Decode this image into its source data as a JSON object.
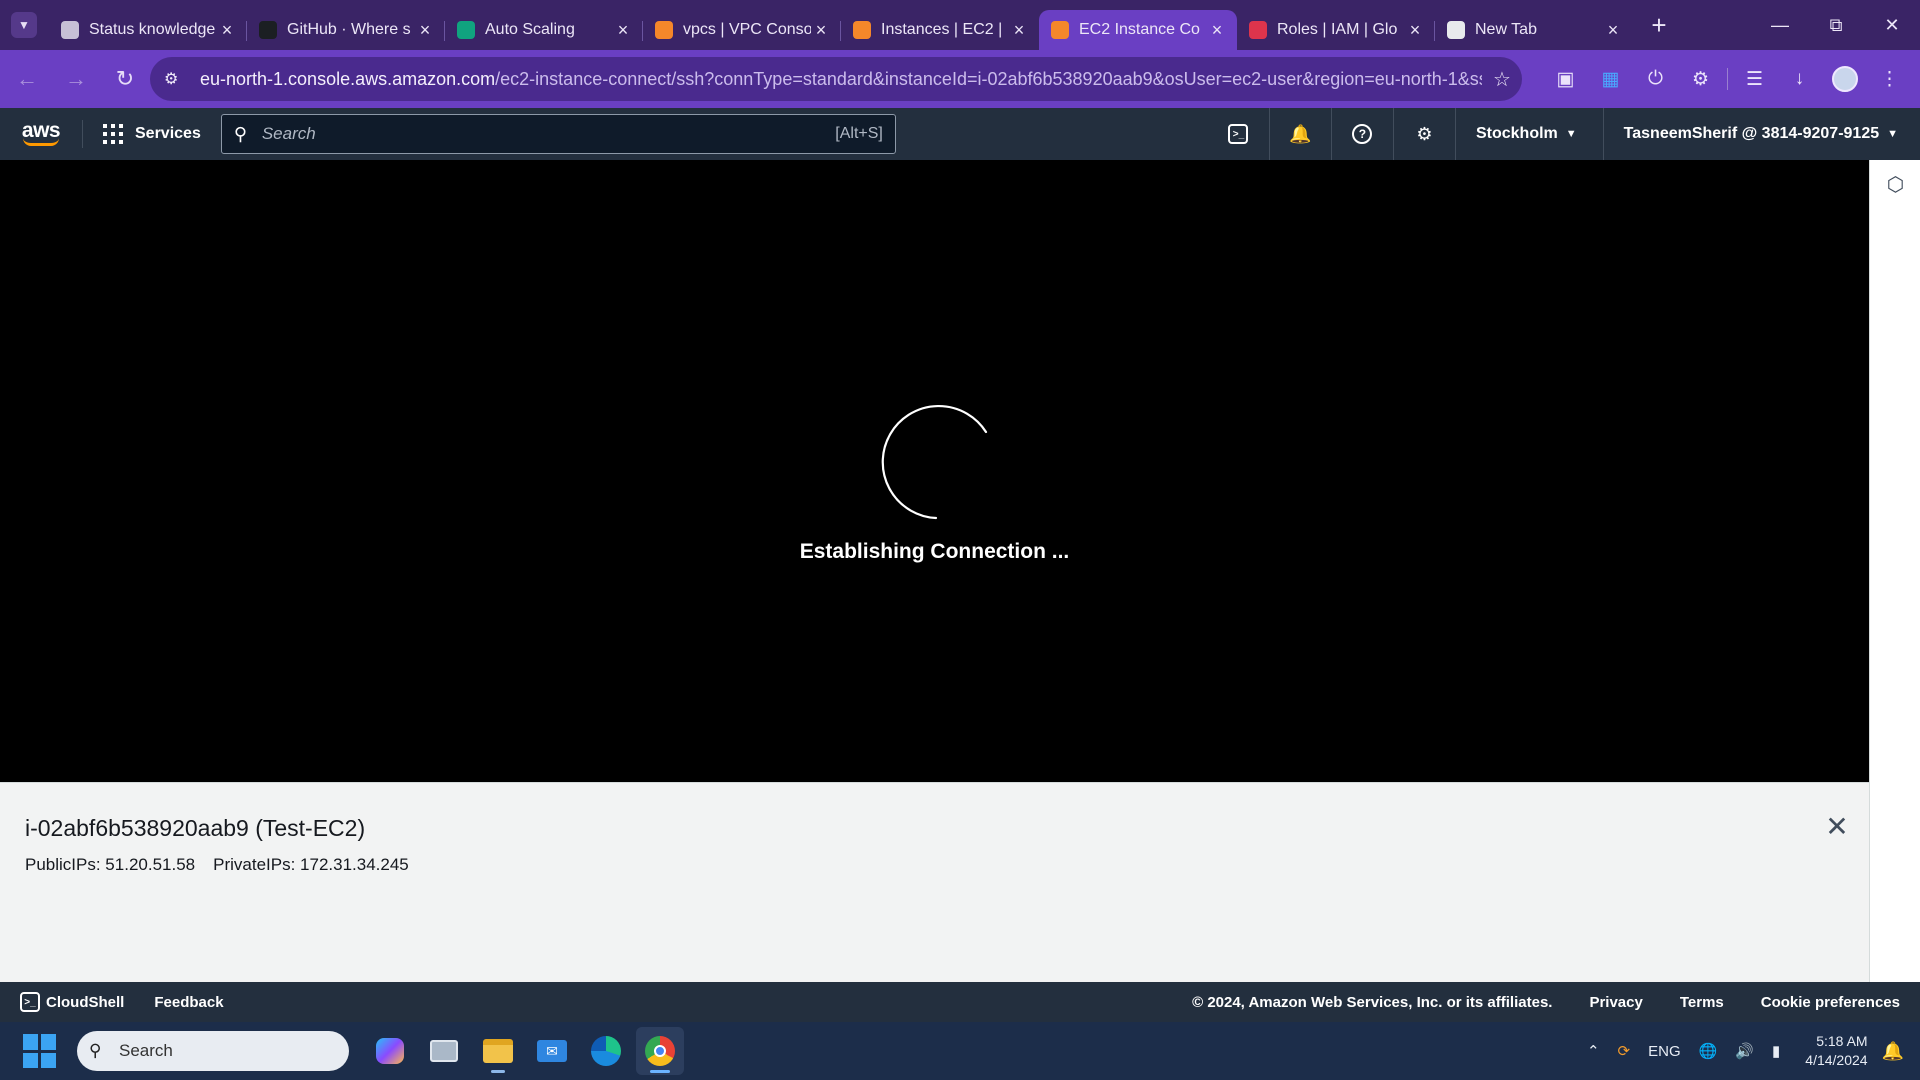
{
  "browser": {
    "tabs": [
      {
        "label": "Status knowledge",
        "favicon": "status-favicon",
        "color": "#c7c0d6",
        "active": false
      },
      {
        "label": "GitHub · Where s",
        "favicon": "github-favicon",
        "color": "#1b1f23",
        "active": false
      },
      {
        "label": "Auto Scaling",
        "favicon": "chatgpt-favicon",
        "color": "#10a37f",
        "active": false
      },
      {
        "label": "vpcs | VPC Conso",
        "favicon": "aws-vpc-favicon",
        "color": "#f5872a",
        "active": false
      },
      {
        "label": "Instances | EC2 |",
        "favicon": "aws-ec2-favicon",
        "color": "#f5872a",
        "active": false
      },
      {
        "label": "EC2 Instance Co",
        "favicon": "aws-ec2-favicon",
        "color": "#f5872a",
        "active": true
      },
      {
        "label": "Roles | IAM | Glo",
        "favicon": "aws-iam-favicon",
        "color": "#dd344c",
        "active": false
      },
      {
        "label": "New Tab",
        "favicon": "chrome-favicon",
        "color": "#e8eaed",
        "active": false
      }
    ],
    "url_host": "eu-north-1.console.aws.amazon.com",
    "url_path": "/ec2-instance-connect/ssh?connType=standard&instanceId=i-02abf6b538920aab9&osUser=ec2-user&region=eu-north-1&ss..."
  },
  "aws": {
    "logo_text": "aws",
    "services_label": "Services",
    "search_placeholder": "Search",
    "search_shortcut": "[Alt+S]",
    "region": "Stockholm",
    "account": "TasneemSherif @ 3814-9207-9125"
  },
  "connect": {
    "status": "Establishing Connection ...",
    "instance_title": "i-02abf6b538920aab9 (Test-EC2)",
    "public_ips": "PublicIPs: 51.20.51.58",
    "private_ips": "PrivateIPs: 172.31.34.245"
  },
  "footer": {
    "cloudshell": "CloudShell",
    "feedback": "Feedback",
    "copyright": "© 2024, Amazon Web Services, Inc. or its affiliates.",
    "privacy": "Privacy",
    "terms": "Terms",
    "cookies": "Cookie preferences"
  },
  "taskbar": {
    "search_placeholder": "Search",
    "lang": "ENG",
    "time": "5:18 AM",
    "date": "4/14/2024"
  },
  "colors": {
    "browser_frame": "#3a2466",
    "browser_toolbar": "#6a3fc3",
    "aws_squid_ink": "#232f3e",
    "aws_orange": "#ff9900"
  }
}
